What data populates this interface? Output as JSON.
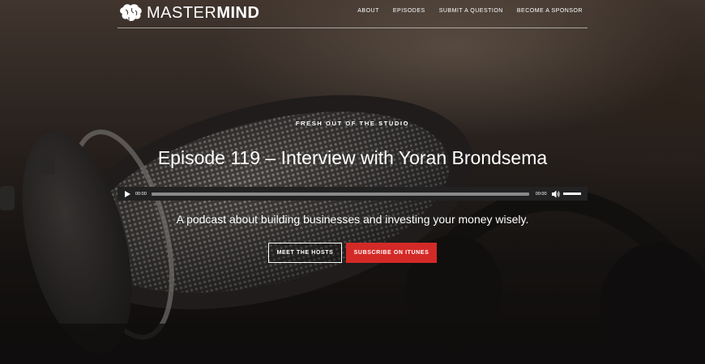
{
  "brand": {
    "name_light": "MASTER",
    "name_bold": "MIND"
  },
  "nav": {
    "items": [
      "ABOUT",
      "EPISODES",
      "SUBMIT A QUESTION",
      "BECOME A SPONSOR"
    ]
  },
  "hero": {
    "kicker": "FRESH OUT OF THE STUDIO",
    "title": "Episode 119 – Interview with Yoran Brondsema",
    "tagline": "A podcast about building businesses and investing your money wisely."
  },
  "player": {
    "current_time": "00:00",
    "duration": "00:00",
    "progress_percent": 0,
    "volume_percent": 100
  },
  "buttons": {
    "hosts_label": "MEET THE HOSTS",
    "itunes_label": "SUBSCRIBE ON ITUNES"
  },
  "colors": {
    "accent": "#d42a27",
    "player_bg": "#222222"
  }
}
